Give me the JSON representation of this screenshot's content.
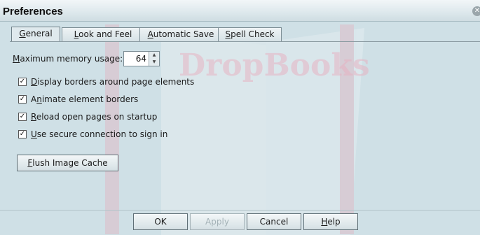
{
  "window": {
    "title": "Preferences",
    "close_icon": "close-icon"
  },
  "tabs": [
    {
      "label": "General",
      "accel": "G",
      "rest": "eneral",
      "active": true
    },
    {
      "label": "Look and Feel",
      "accel": "L",
      "rest": "ook and Feel",
      "active": false
    },
    {
      "label": "Automatic Save",
      "accel": "A",
      "rest": "utomatic Save",
      "active": false
    },
    {
      "label": "Spell Check",
      "accel": "S",
      "rest": "pell Check",
      "active": false
    }
  ],
  "memory": {
    "accel": "M",
    "label_rest": "aximum memory usage:",
    "value": "64"
  },
  "checkboxes": [
    {
      "pre": "",
      "accel": "D",
      "post": "isplay borders around page elements",
      "checked": true
    },
    {
      "pre": "A",
      "accel": "n",
      "post": "imate element borders",
      "checked": true
    },
    {
      "pre": "",
      "accel": "R",
      "post": "eload open pages on startup",
      "checked": true
    },
    {
      "pre": "",
      "accel": "U",
      "post": "se secure connection to sign in",
      "checked": true
    }
  ],
  "flush": {
    "accel": "F",
    "rest": "lush Image Cache"
  },
  "buttons": {
    "ok": "OK",
    "apply": "Apply",
    "cancel": "Cancel",
    "help_accel": "H",
    "help_rest": "elp"
  },
  "watermark": {
    "text": "DropBooks"
  }
}
